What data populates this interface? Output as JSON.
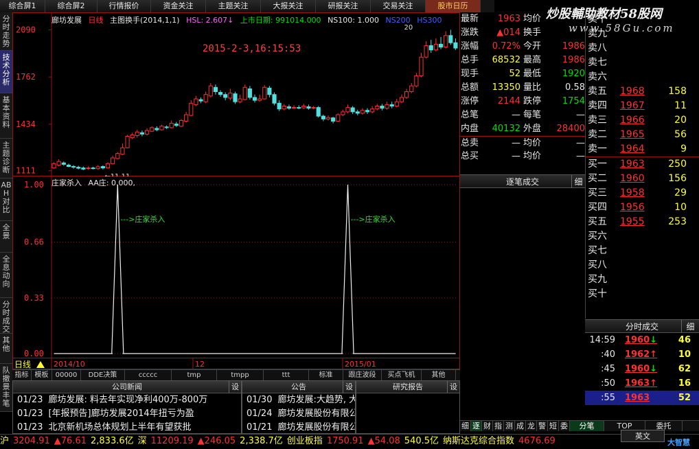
{
  "top_tabs": [
    {
      "label": "综合屏1",
      "w": 66
    },
    {
      "label": "综合屏2",
      "w": 76
    },
    {
      "label": "行情报价",
      "w": 78
    },
    {
      "label": "资金关注",
      "w": 80
    },
    {
      "label": "主题关注",
      "w": 80
    },
    {
      "label": "大报关注",
      "w": 80
    },
    {
      "label": "研报关注",
      "w": 80
    },
    {
      "label": "交易关注",
      "w": 80
    },
    {
      "label": "股市日历",
      "w": 80
    }
  ],
  "watermark": {
    "title": "炒股輔助教材58股网",
    "sub": "www.58Gu.com"
  },
  "left_tabs": [
    {
      "label": "分时走势",
      "h": 56
    },
    {
      "label": "技术分析",
      "h": 62
    },
    {
      "label": "基本资料",
      "h": 66
    },
    {
      "label": "主题诊断",
      "h": 58
    },
    {
      "label": "ABH对比",
      "h": 62
    },
    {
      "label": "全景",
      "h": 46
    },
    {
      "label": "全息动向",
      "h": 66
    },
    {
      "label": "分时成交",
      "h": 52
    },
    {
      "label": "其他",
      "h": 44
    },
    {
      "label": "队撤景丰笔",
      "h": 70
    }
  ],
  "chart": {
    "stock_name": "廊坊发展",
    "period": "日线",
    "indicator_name": "主图换手(2014,1,1)",
    "hsl": "HSL: 2.607↓",
    "listing": "上市日期: 991014.000",
    "ns100": "NS100: 1.000",
    "ns200": "NS200",
    "hs300": "HS300",
    "timestamp": "2015-2-3,16:15:53",
    "min_label": "11.11",
    "max_label": "20",
    "y_ticks": [
      "2090",
      "1762",
      "1434",
      "1111"
    ],
    "ind_title": "庄家杀入",
    "ind_value": "AA庄: 0.000,",
    "ind_y_ticks": [
      "1.00",
      "0.66",
      "0.33",
      "0.00"
    ],
    "ind_annotation": "--->庄家杀入",
    "x_labels": [
      "2014/10",
      "12",
      "2015/01"
    ],
    "period_tag": "日线"
  },
  "chart_data": {
    "type": "candlestick",
    "ylim": [
      1090,
      2130
    ],
    "candles": [
      [
        1130,
        1160,
        1125,
        1170
      ],
      [
        1150,
        1175,
        1140,
        1190
      ],
      [
        1165,
        1155,
        1145,
        1175
      ],
      [
        1150,
        1140,
        1135,
        1160
      ],
      [
        1140,
        1135,
        1125,
        1150
      ],
      [
        1135,
        1128,
        1120,
        1145
      ],
      [
        1130,
        1122,
        1115,
        1140
      ],
      [
        1125,
        1130,
        1118,
        1140
      ],
      [
        1130,
        1125,
        1120,
        1138
      ],
      [
        1125,
        1138,
        1118,
        1150
      ],
      [
        1140,
        1130,
        1120,
        1148
      ],
      [
        1130,
        1160,
        1125,
        1170
      ],
      [
        1160,
        1200,
        1155,
        1215
      ],
      [
        1195,
        1230,
        1188,
        1240
      ],
      [
        1225,
        1270,
        1220,
        1300
      ],
      [
        1270,
        1350,
        1265,
        1360
      ],
      [
        1340,
        1360,
        1330,
        1375
      ],
      [
        1355,
        1380,
        1340,
        1395
      ],
      [
        1375,
        1365,
        1350,
        1390
      ],
      [
        1365,
        1390,
        1355,
        1405
      ],
      [
        1385,
        1410,
        1380,
        1420
      ],
      [
        1405,
        1395,
        1385,
        1420
      ],
      [
        1395,
        1420,
        1390,
        1430
      ],
      [
        1415,
        1410,
        1400,
        1425
      ],
      [
        1410,
        1440,
        1405,
        1460
      ],
      [
        1435,
        1425,
        1415,
        1450
      ],
      [
        1420,
        1460,
        1415,
        1470
      ],
      [
        1455,
        1500,
        1445,
        1520
      ],
      [
        1495,
        1580,
        1490,
        1600
      ],
      [
        1570,
        1610,
        1560,
        1630
      ],
      [
        1605,
        1595,
        1580,
        1620
      ],
      [
        1590,
        1640,
        1580,
        1660
      ],
      [
        1630,
        1700,
        1620,
        1720
      ],
      [
        1690,
        1660,
        1640,
        1710
      ],
      [
        1655,
        1640,
        1625,
        1670
      ],
      [
        1640,
        1620,
        1600,
        1655
      ],
      [
        1615,
        1650,
        1600,
        1680
      ],
      [
        1645,
        1590,
        1575,
        1660
      ],
      [
        1590,
        1610,
        1580,
        1640
      ],
      [
        1605,
        1690,
        1600,
        1710
      ],
      [
        1680,
        1620,
        1605,
        1700
      ],
      [
        1620,
        1600,
        1585,
        1640
      ],
      [
        1600,
        1610,
        1590,
        1640
      ],
      [
        1610,
        1690,
        1605,
        1705
      ],
      [
        1685,
        1640,
        1620,
        1700
      ],
      [
        1640,
        1580,
        1565,
        1655
      ],
      [
        1580,
        1540,
        1525,
        1600
      ],
      [
        1540,
        1560,
        1530,
        1575
      ],
      [
        1555,
        1545,
        1535,
        1570
      ],
      [
        1545,
        1550,
        1540,
        1565
      ],
      [
        1550,
        1548,
        1538,
        1565
      ],
      [
        1548,
        1560,
        1540,
        1575
      ],
      [
        1555,
        1545,
        1535,
        1570
      ],
      [
        1545,
        1550,
        1538,
        1560
      ],
      [
        1550,
        1490,
        1480,
        1560
      ],
      [
        1490,
        1470,
        1455,
        1500
      ],
      [
        1470,
        1480,
        1460,
        1495
      ],
      [
        1478,
        1455,
        1440,
        1485
      ],
      [
        1455,
        1500,
        1450,
        1510
      ],
      [
        1500,
        1520,
        1490,
        1535
      ],
      [
        1520,
        1550,
        1510,
        1570
      ],
      [
        1548,
        1520,
        1505,
        1560
      ],
      [
        1520,
        1510,
        1495,
        1535
      ],
      [
        1510,
        1530,
        1500,
        1545
      ],
      [
        1530,
        1520,
        1505,
        1545
      ],
      [
        1520,
        1540,
        1510,
        1560
      ],
      [
        1540,
        1560,
        1530,
        1575
      ],
      [
        1560,
        1545,
        1530,
        1575
      ],
      [
        1545,
        1570,
        1535,
        1590
      ],
      [
        1570,
        1560,
        1545,
        1590
      ],
      [
        1560,
        1590,
        1550,
        1610
      ],
      [
        1590,
        1620,
        1580,
        1640
      ],
      [
        1620,
        1660,
        1610,
        1680
      ],
      [
        1660,
        1700,
        1650,
        1720
      ],
      [
        1700,
        1770,
        1690,
        1790
      ],
      [
        1770,
        1900,
        1760,
        1930
      ],
      [
        1900,
        1980,
        1890,
        2010
      ],
      [
        1980,
        1950,
        1930,
        2020
      ],
      [
        1950,
        1990,
        1940,
        2030
      ],
      [
        1990,
        1970,
        1955,
        2040
      ],
      [
        1970,
        2050,
        1960,
        2080
      ],
      [
        2050,
        2000,
        1985,
        2090
      ],
      [
        2000,
        1963,
        1950,
        2030
      ]
    ],
    "indicator": {
      "name": "AA庄",
      "spikes_at": [
        13,
        60
      ],
      "baseline": 0,
      "peak": 1
    }
  },
  "ind_tabs": [
    {
      "label": "指标",
      "w": 28
    },
    {
      "label": "模板",
      "w": 30
    },
    {
      "label": "00000",
      "w": 42
    },
    {
      "label": "DDE决策",
      "w": 64
    },
    {
      "label": "ccccc",
      "w": 68
    },
    {
      "label": "tmp",
      "w": 66
    },
    {
      "label": "tmpp",
      "w": 68
    },
    {
      "label": "ttt",
      "w": 66
    },
    {
      "label": "标准",
      "w": 50
    },
    {
      "label": "跟庄波段",
      "w": 56
    },
    {
      "label": "买点飞机",
      "w": 58
    },
    {
      "label": "其他",
      "w": 50
    }
  ],
  "news": {
    "panels": [
      {
        "title": "公司新闻",
        "rows": [
          {
            "date": "01/23",
            "text": "廊坊发展: 料去年实现净利400万-800万"
          },
          {
            "date": "01/23",
            "text": "[年报预告]廊坊发展2014年扭亏为盈"
          },
          {
            "date": "01/23",
            "text": "北京新机场总体规划上半年有望获批"
          }
        ]
      },
      {
        "title": "公告",
        "rows": [
          {
            "date": "01/30",
            "text": "廊坊发展:大趋势, 大空间"
          },
          {
            "date": "01/24",
            "text": "廊坊发展股份有限公司2014年年度业绩"
          },
          {
            "date": "01/21",
            "text": "廊坊发展股份有限公司股票交易异常"
          }
        ]
      },
      {
        "title": "研究报告",
        "rows": []
      }
    ],
    "set_label": "设"
  },
  "quote": {
    "rows": [
      {
        "l1": "最新",
        "v1": "1963",
        "c1": "red",
        "l2": "均价",
        "v2": "",
        "c2": "red"
      },
      {
        "l1": "涨跌",
        "v1": "▲014",
        "c1": "red",
        "l2": "换手",
        "v2": "",
        "c2": "white"
      },
      {
        "l1": "涨幅",
        "v1": "0.72%",
        "c1": "red",
        "l2": "今开",
        "v2": "1986",
        "c2": "red"
      },
      {
        "l1": "总手",
        "v1": "68532",
        "c1": "yellow",
        "l2": "最高",
        "v2": "1986",
        "c2": "red"
      },
      {
        "l1": "现手",
        "v1": "52",
        "c1": "yellow",
        "l2": "最低",
        "v2": "1920",
        "c2": "green"
      },
      {
        "l1": "总额",
        "v1": "13350",
        "c1": "yellow",
        "l2": "量比",
        "v2": "0.58",
        "c2": "white"
      },
      {
        "l1": "涨停",
        "v1": "2144",
        "c1": "red",
        "l2": "跌停",
        "v2": "1754",
        "c2": "green"
      },
      {
        "l1": "总笔",
        "v1": "—",
        "c1": "white",
        "l2": "每笔",
        "v2": "—",
        "c2": "white"
      },
      {
        "l1": "内盘",
        "v1": "40132",
        "c1": "green",
        "l2": "外盘",
        "v2": "28400",
        "c2": "red"
      },
      {
        "l1": "总卖",
        "v1": "—",
        "c1": "white",
        "l2": "均价",
        "v2": "—",
        "c2": "white"
      },
      {
        "l1": "总买",
        "v1": "—",
        "c1": "white",
        "l2": "均价",
        "v2": "—",
        "c2": "white"
      }
    ],
    "zhubi_title": "逐笔成交",
    "zhubi_btn": "细"
  },
  "orderbook": {
    "asks": [
      {
        "label": "卖十",
        "price": "",
        "vol": ""
      },
      {
        "label": "卖九",
        "price": "",
        "vol": ""
      },
      {
        "label": "卖八",
        "price": "",
        "vol": ""
      },
      {
        "label": "卖七",
        "price": "",
        "vol": ""
      },
      {
        "label": "卖六",
        "price": "",
        "vol": ""
      },
      {
        "label": "卖五",
        "price": "1968",
        "vol": "158"
      },
      {
        "label": "卖四",
        "price": "1967",
        "vol": "11"
      },
      {
        "label": "卖三",
        "price": "1966",
        "vol": "20"
      },
      {
        "label": "卖二",
        "price": "1965",
        "vol": "56"
      },
      {
        "label": "卖一",
        "price": "1964",
        "vol": "9"
      }
    ],
    "bids": [
      {
        "label": "买一",
        "price": "1963",
        "vol": "250"
      },
      {
        "label": "买二",
        "price": "1960",
        "vol": "156"
      },
      {
        "label": "买三",
        "price": "1958",
        "vol": "29"
      },
      {
        "label": "买四",
        "price": "1956",
        "vol": "10"
      },
      {
        "label": "买五",
        "price": "1955",
        "vol": "253"
      },
      {
        "label": "买六",
        "price": "",
        "vol": ""
      },
      {
        "label": "买七",
        "price": "",
        "vol": ""
      },
      {
        "label": "买八",
        "price": "",
        "vol": ""
      },
      {
        "label": "买九",
        "price": "",
        "vol": ""
      },
      {
        "label": "买十",
        "price": "",
        "vol": ""
      }
    ]
  },
  "timesales": {
    "title": "分时成交",
    "btn": "细",
    "rows": [
      {
        "time": "14:59",
        "price": "1960",
        "dir": "↓",
        "pc": "red",
        "dc": "green",
        "vol": "46"
      },
      {
        "time": ":40",
        "price": "1962",
        "dir": "↑",
        "pc": "red",
        "dc": "red",
        "vol": "10"
      },
      {
        "time": ":45",
        "price": "1960",
        "dir": "↓",
        "pc": "red",
        "dc": "green",
        "vol": "62"
      },
      {
        "time": ":50",
        "price": "1963",
        "dir": "↑",
        "pc": "red",
        "dc": "red",
        "vol": "16"
      },
      {
        "time": ":55",
        "price": "1963",
        "dir": "",
        "pc": "red",
        "dc": "red",
        "vol": "52"
      }
    ]
  },
  "right_tabs": [
    {
      "label": "细",
      "w": 16
    },
    {
      "label": "逐",
      "w": 16,
      "active": true
    },
    {
      "label": "财",
      "w": 16
    },
    {
      "label": "指",
      "w": 16
    },
    {
      "label": "测",
      "w": 16
    },
    {
      "label": "成",
      "w": 16
    },
    {
      "label": "龙",
      "w": 16
    },
    {
      "label": "警",
      "w": 16
    },
    {
      "label": "短",
      "w": 16
    },
    {
      "label": "委",
      "w": 16
    },
    {
      "label": "分笔",
      "w": 50,
      "active": true
    },
    {
      "label": "TOP",
      "w": 60
    },
    {
      "label": "委托",
      "w": 54
    }
  ],
  "statusbar": [
    {
      "text": "沪",
      "c": "yellow"
    },
    {
      "text": "3204.91",
      "c": "red"
    },
    {
      "text": "▲76.61",
      "c": "red"
    },
    {
      "text": "2,833.6亿",
      "c": "yellow"
    },
    {
      "text": "深",
      "c": "yellow"
    },
    {
      "text": "11209.19",
      "c": "red"
    },
    {
      "text": "▲246.05",
      "c": "red"
    },
    {
      "text": "2,338.7亿",
      "c": "yellow"
    },
    {
      "text": "创业板指",
      "c": "yellow"
    },
    {
      "text": "1750.91",
      "c": "red"
    },
    {
      "text": "▲54.08",
      "c": "red"
    },
    {
      "text": "540.5亿",
      "c": "yellow"
    },
    {
      "text": "纳斯达克综合指数",
      "c": "yellow"
    },
    {
      "text": "4676.69",
      "c": "red"
    }
  ],
  "ime": {
    "label": "英文",
    "logo": "大智慧"
  }
}
